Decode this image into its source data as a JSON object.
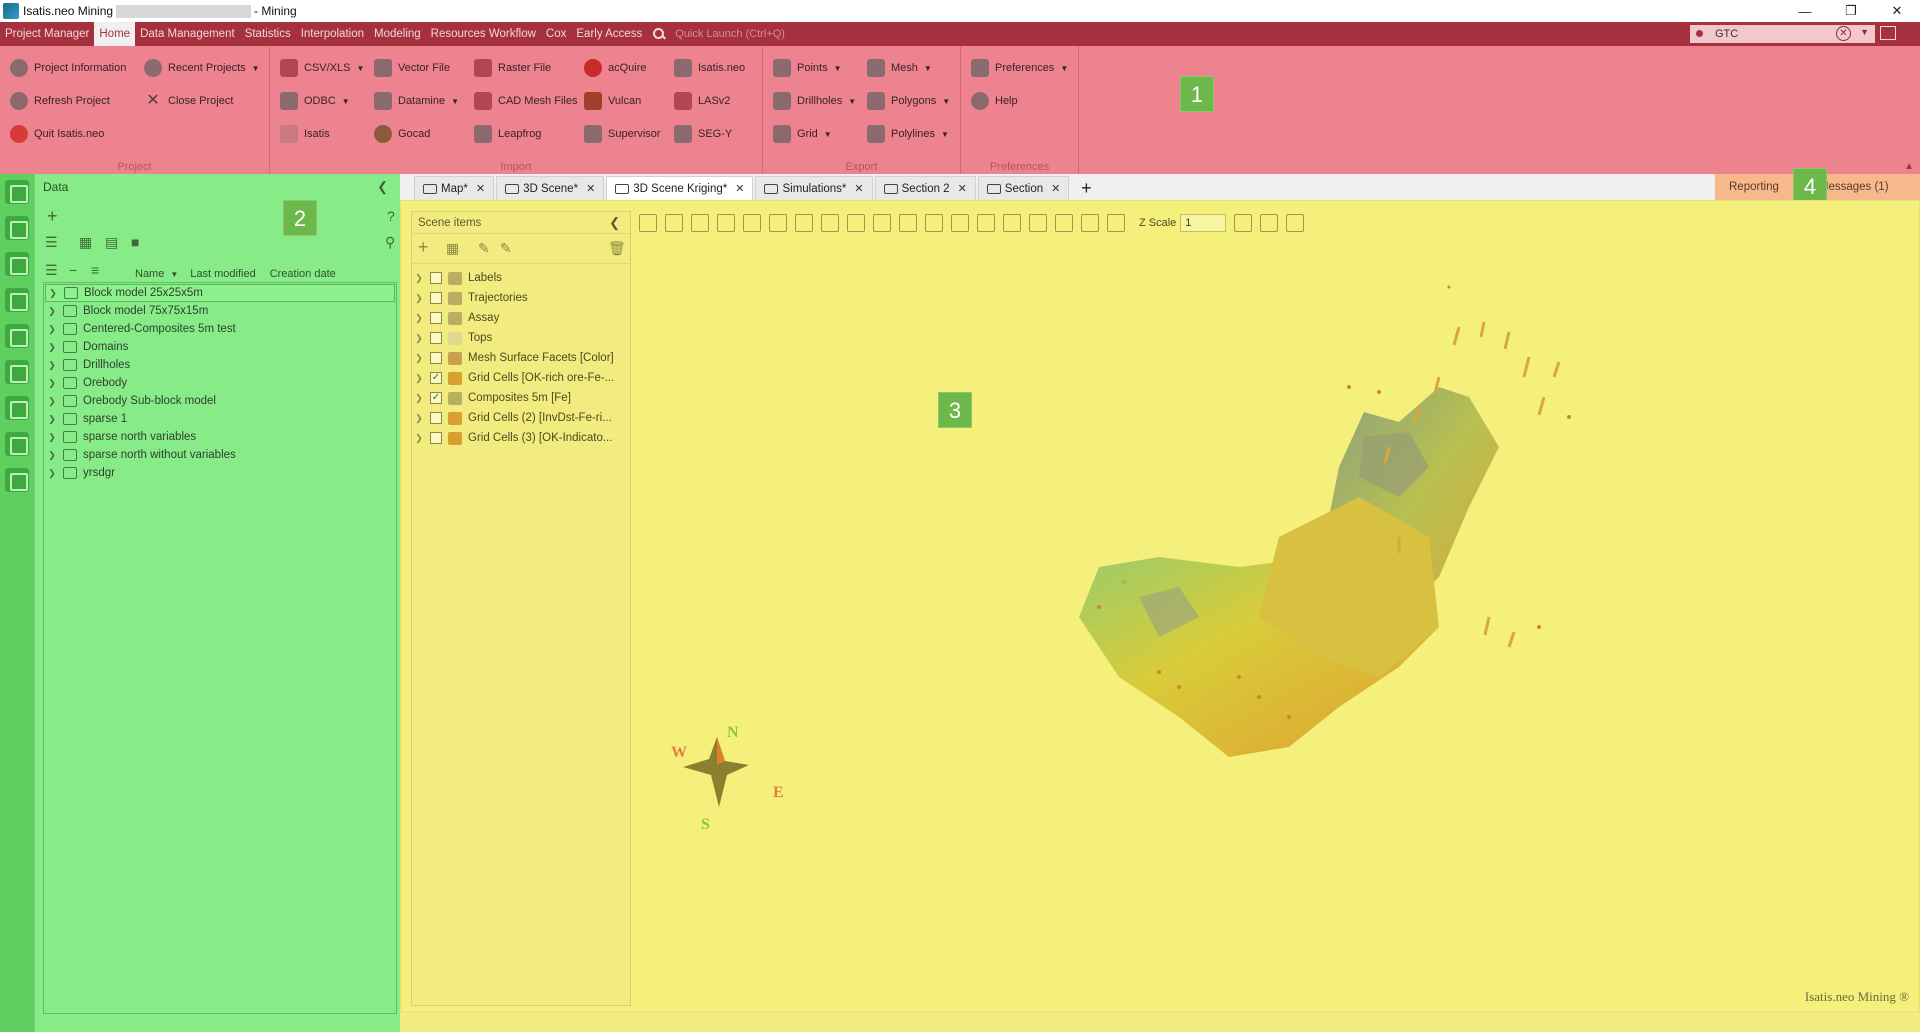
{
  "window": {
    "title_prefix": "Isatis.neo Mining",
    "title_suffix": "- Mining"
  },
  "menubar": {
    "items": [
      "Project Manager",
      "Home",
      "Data Management",
      "Statistics",
      "Interpolation",
      "Modeling",
      "Resources Workflow",
      "Cox",
      "Early Access"
    ],
    "active_index": 1,
    "quick_launch_placeholder": "Quick Launch (Ctrl+Q)",
    "search_value": "GTC"
  },
  "ribbon": {
    "groups": {
      "project": "Project",
      "import": "Import",
      "export": "Export",
      "preferences": "Preferences"
    },
    "project": {
      "project_information": "Project Information",
      "recent_projects": "Recent Projects",
      "refresh_project": "Refresh Project",
      "close_project": "Close Project",
      "quit": "Quit Isatis.neo"
    },
    "import": {
      "csv": "CSV/XLS",
      "vector_file": "Vector File",
      "raster_file": "Raster File",
      "acquire": "acQuire",
      "isatisneo": "Isatis.neo",
      "odbc": "ODBC",
      "datamine": "Datamine",
      "cad_mesh": "CAD Mesh Files",
      "vulcan": "Vulcan",
      "lasv2": "LASv2",
      "isatis": "Isatis",
      "gocad": "Gocad",
      "leapfrog": "Leapfrog",
      "supervisor": "Supervisor",
      "segy": "SEG-Y"
    },
    "export": {
      "points": "Points",
      "mesh": "Mesh",
      "drillholes": "Drillholes",
      "polygons": "Polygons",
      "grid": "Grid",
      "polylines": "Polylines"
    },
    "preferences": {
      "preferences": "Preferences",
      "help": "Help"
    }
  },
  "badges": [
    "1",
    "2",
    "3",
    "4"
  ],
  "data_panel": {
    "title": "Data",
    "columns": [
      "Name",
      "Last modified",
      "Creation date"
    ],
    "items": [
      "Block model 25x25x5m",
      "Block model 75x75x15m",
      "Centered-Composites 5m test",
      "Domains",
      "Drillholes",
      "Orebody",
      "Orebody Sub-block model",
      "sparse 1",
      "sparse north variables",
      "sparse north without variables",
      "yrsdgr"
    ],
    "selected_index": 0
  },
  "tabs": [
    {
      "label": "Map*"
    },
    {
      "label": "3D Scene*"
    },
    {
      "label": "3D Scene Kriging*"
    },
    {
      "label": "Simulations*"
    },
    {
      "label": "Section 2"
    },
    {
      "label": "Section"
    }
  ],
  "active_tab": 2,
  "right_panel": {
    "reporting": "Reporting",
    "messages": "Messages (1)"
  },
  "scene_items": {
    "title": "Scene items",
    "items": [
      {
        "label": "Labels",
        "checked": false
      },
      {
        "label": "Trajectories",
        "checked": false
      },
      {
        "label": "Assay",
        "checked": false
      },
      {
        "label": "Tops",
        "checked": false
      },
      {
        "label": "Mesh Surface Facets [Color]",
        "checked": false
      },
      {
        "label": "Grid Cells [OK-rich ore-Fe-...",
        "checked": true
      },
      {
        "label": "Composites 5m [Fe]",
        "checked": true
      },
      {
        "label": "Grid Cells (2) [InvDst-Fe-ri...",
        "checked": false
      },
      {
        "label": "Grid Cells (3) [OK-Indicato...",
        "checked": false
      }
    ]
  },
  "toolbar": {
    "zscale_label": "Z Scale",
    "zscale_value": "1"
  },
  "compass": {
    "n": "N",
    "s": "S",
    "e": "E",
    "w": "W"
  },
  "watermark": "Isatis.neo Mining ®",
  "colors": {
    "ribbon": "#ec838e",
    "menubar": "#a5313f",
    "data_panel": "#87ec87",
    "scene": "#f5f07c",
    "messages": "#f7b98c"
  }
}
